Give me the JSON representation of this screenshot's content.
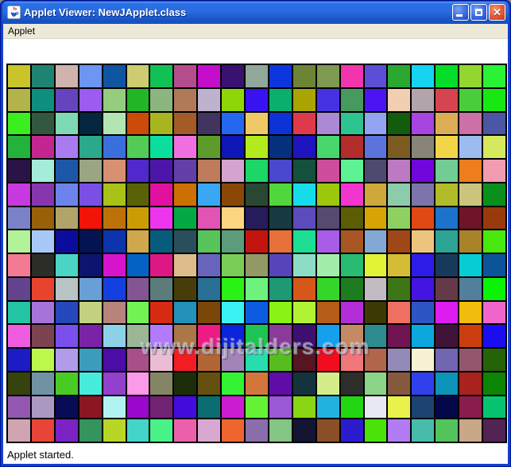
{
  "window": {
    "title": "Applet Viewer: NewJApplet.class",
    "controls": {
      "minimize": "minimize",
      "maximize": "maximize",
      "close_glyph": "✕"
    }
  },
  "menu": {
    "items": [
      {
        "label": "Applet"
      }
    ]
  },
  "applet": {
    "watermark": "www.dijitalders.com",
    "grid": {
      "columns": 21,
      "rows": 16,
      "cell_colors": [
        [
          "#c9c42a",
          "#1f8372",
          "#cfb3ac",
          "#6c96f2",
          "#10559f",
          "#cdcc70",
          "#12c153",
          "#b54d8d",
          "#c40ecb",
          "#3a1070",
          "#8fa899",
          "#0c35e0",
          "#6d8434",
          "#7d9952",
          "#f235ad",
          "#5a4fd6",
          "#2aa832",
          "#14d4f2",
          "#04dd2a",
          "#94d630",
          "#2af235"
        ],
        [
          "#b3b34c",
          "#0e8f7e",
          "#6544bd",
          "#9c5cef",
          "#93cd7d",
          "#22b525",
          "#8cb580",
          "#b07a58",
          "#bdb3cf",
          "#8ed607",
          "#3812ef",
          "#0cae6e",
          "#aaa403",
          "#4632e2",
          "#489960",
          "#4b14f2",
          "#f2cfb2",
          "#b2a4ab",
          "#d64450",
          "#4bcc3b",
          "#17e814"
        ],
        [
          "#3bee1d",
          "#32593f",
          "#7edab4",
          "#042640",
          "#b2e5b2",
          "#cc4b08",
          "#a8b51e",
          "#a35c28",
          "#413560",
          "#2568ef",
          "#efc868",
          "#0c33d6",
          "#dd3a4c",
          "#ab89d4",
          "#2dc491",
          "#93a4f2",
          "#125c0c",
          "#a844e0",
          "#ddad55",
          "#cc70a8",
          "#4b56a4"
        ],
        [
          "#23b33b",
          "#c42691",
          "#a97bef",
          "#2ca98c",
          "#3a70dd",
          "#52cb57",
          "#0bdf9f",
          "#f070e2",
          "#5d9c2a",
          "#0c17b5",
          "#b2ea1e",
          "#04317e",
          "#1d14bd",
          "#48d66d",
          "#b32d2d",
          "#5c72dd",
          "#7d5c22",
          "#888478",
          "#f2d648",
          "#9cbcf0",
          "#d6e85d"
        ],
        [
          "#2a1347",
          "#a5ecd9",
          "#1d58a8",
          "#9aa683",
          "#d89072",
          "#5128cc",
          "#4c17a8",
          "#6340a8",
          "#bd7d5d",
          "#d4a3cf",
          "#1dd668",
          "#4a48cf",
          "#14503c",
          "#cd4d9c",
          "#5df293",
          "#4d4a70",
          "#bc7ac4",
          "#7107dd",
          "#72cc93",
          "#ed7d1d",
          "#f29cb2"
        ],
        [
          "#c73ae0",
          "#8836ad",
          "#6d83ec",
          "#7a4fe3",
          "#a8c217",
          "#5a6207",
          "#e2109f",
          "#cc7004",
          "#3aa7f2",
          "#8a4708",
          "#2a4734",
          "#52d63d",
          "#14dcea",
          "#9cc70c",
          "#f235cc",
          "#cfa83c",
          "#8cccab",
          "#7d74ab",
          "#b2bc2a",
          "#ccc47d",
          "#0a8f1d"
        ],
        [
          "#7b82c9",
          "#99600a",
          "#b1a468",
          "#f21408",
          "#bc7207",
          "#cc9c04",
          "#ec35ec",
          "#04a844",
          "#e055b2",
          "#fcd680",
          "#261c5c",
          "#173a40",
          "#5c4bbc",
          "#564a70",
          "#5c5c04",
          "#d6a404",
          "#8ed160",
          "#e04814",
          "#1d72cc",
          "#701429",
          "#993a0c"
        ],
        [
          "#b2f299",
          "#a8c9f7",
          "#0c0c9c",
          "#041453",
          "#0c35ad",
          "#cfa84d",
          "#085c7b",
          "#2a4f5c",
          "#57c45c",
          "#5c9c7b",
          "#c41410",
          "#e8703a",
          "#1ddd93",
          "#a85ce8",
          "#a85623",
          "#84a8d6",
          "#a04718",
          "#ecc47e",
          "#2da393",
          "#a8832a",
          "#48e80c"
        ],
        [
          "#f27b93",
          "#2d2d28",
          "#4bd4c4",
          "#0c1470",
          "#d614cc",
          "#0462c4",
          "#dd1784",
          "#ddbc8c",
          "#6864bc",
          "#7bcc57",
          "#939965",
          "#5744bc",
          "#8cddc4",
          "#a4ecab",
          "#27bc72",
          "#e2f235",
          "#d4bc35",
          "#2d1ce8",
          "#173a5c",
          "#08ccd4",
          "#0c5499"
        ],
        [
          "#64438f",
          "#e8442d",
          "#b8c4c4",
          "#689fd6",
          "#1440e2",
          "#845593",
          "#5c7b7b",
          "#473d0a",
          "#2a7093",
          "#2af214",
          "#6ef27e",
          "#1d9974",
          "#d6571a",
          "#35d62a",
          "#1d7b20",
          "#c2bcc2",
          "#3d7617",
          "#4414e2",
          "#643a48",
          "#527f9c",
          "#0cf204"
        ],
        [
          "#23c4a4",
          "#a474d9",
          "#2548bc",
          "#c4d180",
          "#b8837b",
          "#72f255",
          "#d62b12",
          "#2391b8",
          "#7b4708",
          "#3af2f2",
          "#0c5ce2",
          "#8af214",
          "#b2f235",
          "#b55c17",
          "#b32dd6",
          "#3d3a04",
          "#ef7060",
          "#2d56c4",
          "#dd1cf2",
          "#f2bc0c",
          "#ef65cc"
        ],
        [
          "#f05ce0",
          "#7b4450",
          "#7a4fec",
          "#7b23a8",
          "#8cd1e8",
          "#9cb596",
          "#b27bfc",
          "#ab7748",
          "#ec1c84",
          "#0c23dd",
          "#1dc453",
          "#8a3a99",
          "#3d1070",
          "#14a0ec",
          "#c48a65",
          "#2d8a8f",
          "#701453",
          "#0ca8dd",
          "#401438",
          "#cc3d10",
          "#1c0cf2"
        ],
        [
          "#1d1cc4",
          "#bcf74b",
          "#b29ce8",
          "#3d9cbc",
          "#4b0ca8",
          "#a84f8a",
          "#ecbcd4",
          "#f21d23",
          "#b26535",
          "#a484b8",
          "#27ddae",
          "#57bc1d",
          "#571423",
          "#f20c1d",
          "#ef7679",
          "#b2654b",
          "#948ab8",
          "#f7f2d4",
          "#7265b2",
          "#94566d",
          "#256308"
        ],
        [
          "#35440e",
          "#7093a4",
          "#48cc23",
          "#48ecdd",
          "#9340cc",
          "#fc99e8",
          "#848565",
          "#1c2d0c",
          "#645110",
          "#35f235",
          "#d1773d",
          "#600ca8",
          "#14333d",
          "#d4ec8a",
          "#2d2d2a",
          "#8ad488",
          "#84593d",
          "#3040ec",
          "#0c93b8",
          "#a8231d",
          "#0c8404"
        ],
        [
          "#9357b2",
          "#ab99c4",
          "#080c56",
          "#8a1723",
          "#b2f2f2",
          "#9908cc",
          "#702372",
          "#440cdd",
          "#0c6d70",
          "#cc1cd1",
          "#65f235",
          "#9c57d6",
          "#8ad614",
          "#23b2e0",
          "#23d614",
          "#e8e8f2",
          "#e8f24b",
          "#1c4472",
          "#04084b",
          "#8a1c4b",
          "#08c470"
        ],
        [
          "#d1a4b2",
          "#e84438",
          "#7b23c4",
          "#35935c",
          "#b8d626",
          "#44d4c9",
          "#48f287",
          "#ec60ab",
          "#d9a8d1",
          "#ef6530",
          "#8a6dab",
          "#84c484",
          "#141433",
          "#8a4f27",
          "#2d1cce",
          "#4be20c",
          "#b27bf2",
          "#48bcab",
          "#52c45c",
          "#c9a887",
          "#532353"
        ]
      ]
    }
  },
  "statusbar": {
    "text": "Applet started."
  }
}
